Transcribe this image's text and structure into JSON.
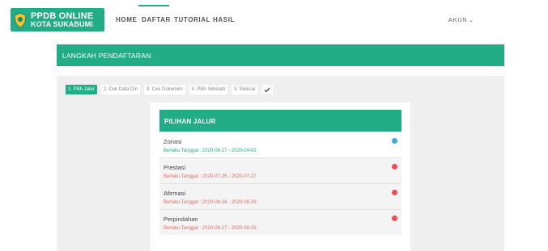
{
  "logo": {
    "line1": "PPDB ONLINE",
    "line2": "KOTA SUKABUMI",
    "icon": "emblem-icon"
  },
  "nav": {
    "home": "HOME",
    "daftar": "DAFTAR",
    "tutorial": "TUTORIAL",
    "hasil": "HASIL",
    "akun": "AKUN",
    "active": "DAFTAR"
  },
  "banner": {
    "title": "LANGKAH PENDAFTARAN"
  },
  "steps": [
    {
      "label": "1. Pilih Jalur",
      "active": true
    },
    {
      "label": "2. Cek Data Diri",
      "active": false
    },
    {
      "label": "3. Cek Dokumen",
      "active": false
    },
    {
      "label": "4. Pilih Sekolah",
      "active": false
    },
    {
      "label": "5. Selesai",
      "active": false
    }
  ],
  "jalur": {
    "title": "PILIHAN JALUR",
    "items": [
      {
        "name": "Zonasi",
        "date": "Berlaku Tanggal : 2020-08-27 - 2020-09-02",
        "status": "open"
      },
      {
        "name": "Prestasi",
        "date": "Berlaku Tanggal : 2020-07-25 - 2020-07-27",
        "status": "closed"
      },
      {
        "name": "Afirmasi",
        "date": "Berlaku Tanggal : 2020-08-26 - 2020-08-29",
        "status": "closed"
      },
      {
        "name": "Perpindahan",
        "date": "Berlaku Tanggal : 2020-08-27 - 2020-08-29",
        "status": "closed"
      }
    ]
  },
  "colors": {
    "brand": "#22ad86",
    "status_ok": "#3ca9d6",
    "status_closed": "#e8505b"
  }
}
